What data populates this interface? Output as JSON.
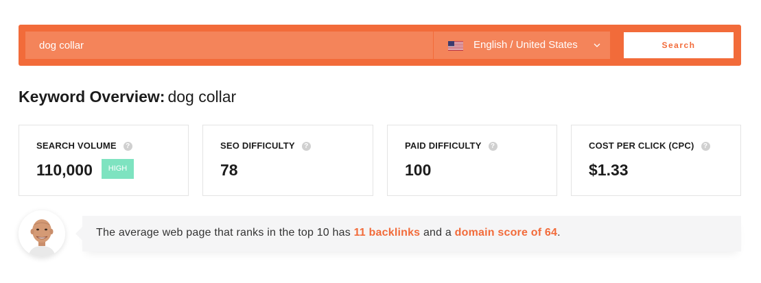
{
  "search": {
    "keyword_value": "dog collar",
    "language_label": "English / United States",
    "search_button_label": "Search"
  },
  "overview": {
    "label": "Keyword Overview:",
    "keyword": "dog collar"
  },
  "metrics": [
    {
      "label": "SEARCH VOLUME",
      "value": "110,000",
      "badge": "HIGH"
    },
    {
      "label": "SEO DIFFICULTY",
      "value": "78"
    },
    {
      "label": "PAID DIFFICULTY",
      "value": "100"
    },
    {
      "label": "COST PER CLICK (CPC)",
      "value": "$1.33"
    }
  ],
  "help_glyph": "?",
  "insight": {
    "prefix": "The average web page that ranks in the top 10 has",
    "backlinks": "11 backlinks",
    "middle": "and a",
    "domain_score": "domain score of 64",
    "suffix": "."
  },
  "colors": {
    "brand_orange": "#f26b3a",
    "input_orange": "#f4845a",
    "badge_green": "#7ee3c0"
  },
  "icons": {
    "flag": "us-flag-icon",
    "dropdown": "chevron-down-icon",
    "help": "help-icon",
    "avatar": "avatar"
  }
}
